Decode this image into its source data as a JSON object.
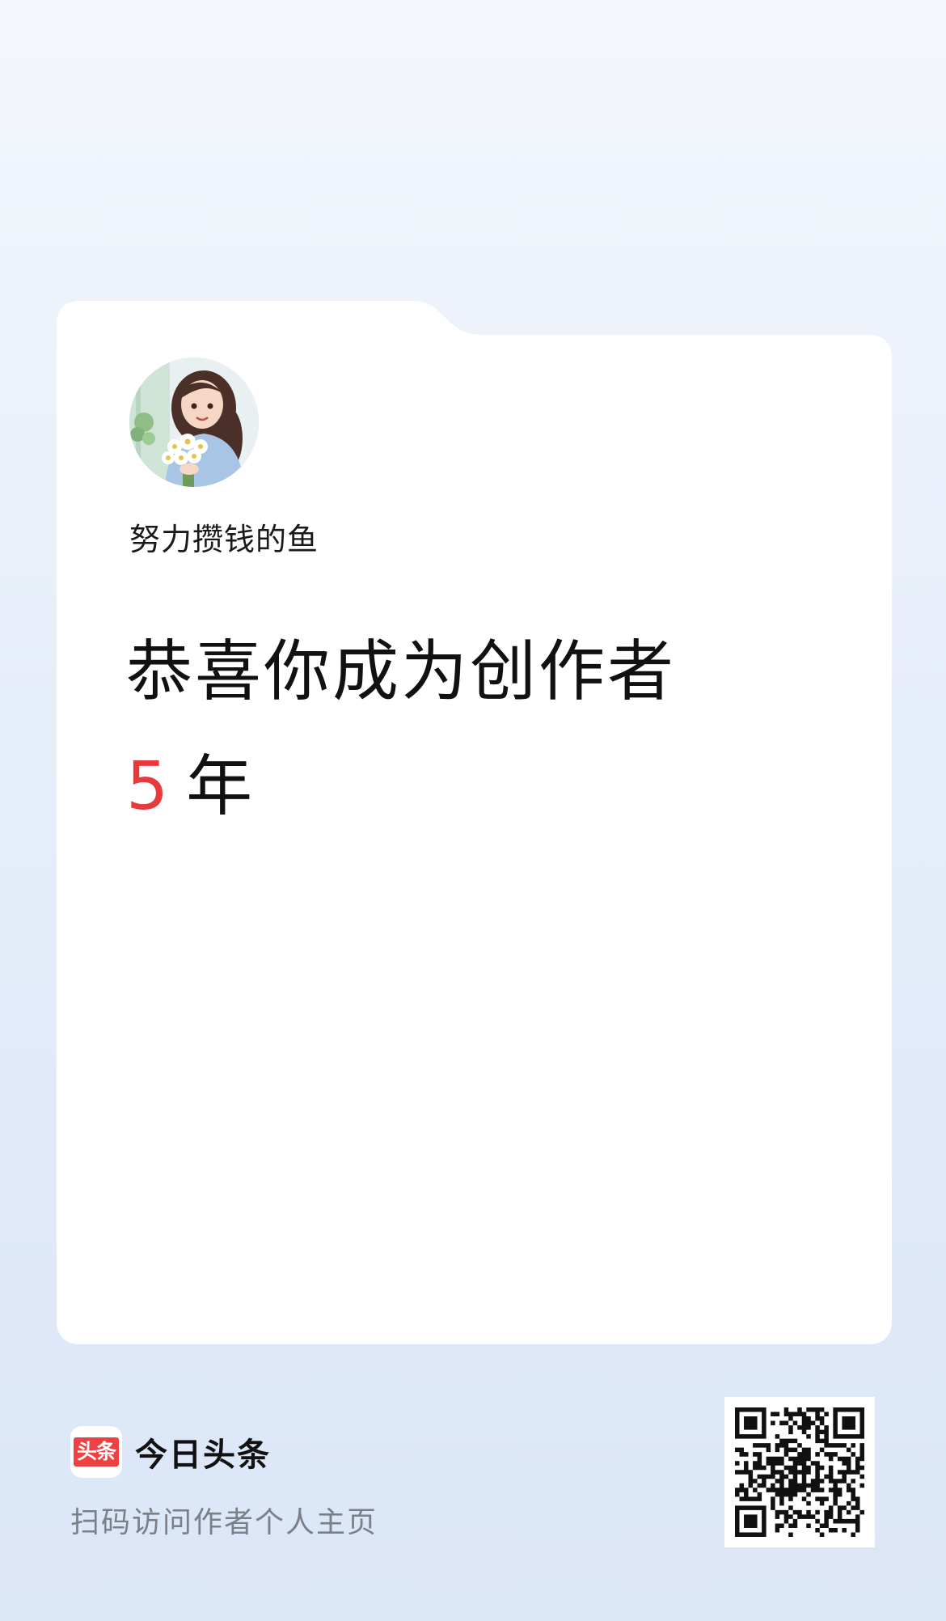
{
  "profile": {
    "username": "努力攒钱的鱼"
  },
  "headline": {
    "text": "恭喜你成为创作者",
    "years_value": "5",
    "years_unit": "年"
  },
  "footer": {
    "brand_logo_text": "头条",
    "brand_name": "今日头条",
    "caption": "扫码访问作者个人主页"
  },
  "colors": {
    "accent": "#e8393c",
    "brand_red": "#f04142",
    "card": "#ffffff",
    "caption_gray": "#7a7f88"
  },
  "icons": {
    "avatar": "avatar-image",
    "brand": "toutiao-logo-icon",
    "qr": "qr-code"
  }
}
